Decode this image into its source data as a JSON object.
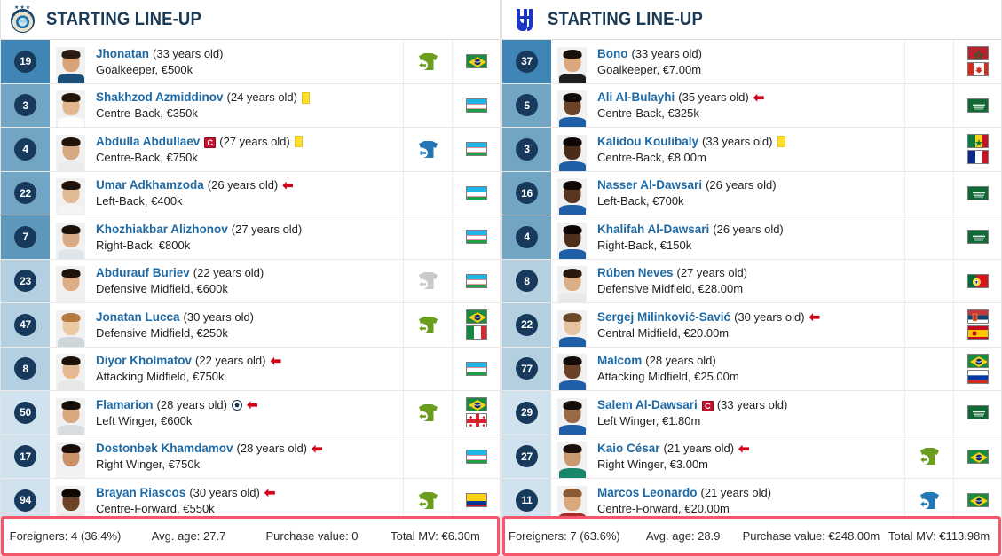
{
  "left": {
    "header": {
      "title": "STARTING LINE-UP",
      "logo_icon": "pakhtakor-crest-icon"
    },
    "players": [
      {
        "number": "19",
        "name": "Jhonatan",
        "age": "(33 years old)",
        "detail": "Goalkeeper, €500k",
        "badges": [],
        "sub_icon": "sub-in-green-shirt-icon",
        "flags": [
          "brazil"
        ],
        "pos_shade": "#3f85b5",
        "skin": "#d8a27a",
        "hair": "#2b1a10",
        "kit": "#1a4f7a"
      },
      {
        "number": "3",
        "name": "Shakhzod Azmiddinov",
        "age": "(24 years old)",
        "detail": "Centre-Back, €350k",
        "badges": [
          "yellow-card"
        ],
        "sub_icon": "",
        "flags": [
          "uzbekistan"
        ],
        "pos_shade": "#72a5c4",
        "skin": "#e0b590",
        "hair": "#241509",
        "kit": "#ffffff"
      },
      {
        "number": "4",
        "name": "Abdulla Abdullaev",
        "age": "(27 years old)",
        "detail": "Centre-Back, €750k",
        "badges": [
          "captain",
          "yellow-card"
        ],
        "sub_icon": "sub-out-blue-shirt-icon",
        "flags": [
          "uzbekistan"
        ],
        "pos_shade": "#72a5c4",
        "skin": "#d7a87f",
        "hair": "#20130a",
        "kit": "#ececec"
      },
      {
        "number": "22",
        "name": "Umar Adkhamzoda",
        "age": "(26 years old)",
        "detail": "Left-Back, €400k",
        "badges": [
          "arrow-out"
        ],
        "sub_icon": "",
        "flags": [
          "uzbekistan"
        ],
        "pos_shade": "#72a5c4",
        "skin": "#e2b996",
        "hair": "#1d1109",
        "kit": "#f4f4f4"
      },
      {
        "number": "7",
        "name": "Khozhiakbar Alizhonov",
        "age": "(27 years old)",
        "detail": "Right-Back, €800k",
        "badges": [],
        "sub_icon": "",
        "flags": [
          "uzbekistan"
        ],
        "pos_shade": "#5d98bb",
        "skin": "#d8ab84",
        "hair": "#1c1008",
        "kit": "#dfe6ea"
      },
      {
        "number": "23",
        "name": "Abdurauf Buriev",
        "age": "(22 years old)",
        "detail": "Defensive Midfield, €600k",
        "badges": [],
        "sub_icon": "sub-grey-shirt-icon",
        "flags": [
          "uzbekistan"
        ],
        "pos_shade": "#b4cfe0",
        "skin": "#dcae86",
        "hair": "#211308",
        "kit": "#f0f0f0"
      },
      {
        "number": "47",
        "name": "Jonatan Lucca",
        "age": "(30 years old)",
        "detail": "Defensive Midfield, €250k",
        "badges": [],
        "sub_icon": "sub-in-green-shirt-icon",
        "flags": [
          "brazil",
          "italy"
        ],
        "pos_shade": "#b4cfe0",
        "skin": "#eccaa6",
        "hair": "#b57a3c",
        "kit": "#cfd6da"
      },
      {
        "number": "8",
        "name": "Diyor Kholmatov",
        "age": "(22 years old)",
        "detail": "Attacking Midfield, €750k",
        "badges": [
          "arrow-out"
        ],
        "sub_icon": "",
        "flags": [
          "uzbekistan"
        ],
        "pos_shade": "#b4cfe0",
        "skin": "#e3b892",
        "hair": "#1b1008",
        "kit": "#e7e7e7"
      },
      {
        "number": "50",
        "name": "Flamarion",
        "age": "(28 years old)",
        "detail": "Left Winger, €600k",
        "badges": [
          "goal",
          "arrow-out"
        ],
        "sub_icon": "sub-in-green-shirt-icon",
        "flags": [
          "brazil",
          "georgia"
        ],
        "pos_shade": "#cfe2ed",
        "skin": "#d9a87c",
        "hair": "#161009",
        "kit": "#d9dde0"
      },
      {
        "number": "17",
        "name": "Dostonbek Khamdamov",
        "age": "(28 years old)",
        "detail": "Right Winger, €750k",
        "badges": [
          "arrow-out"
        ],
        "sub_icon": "",
        "flags": [
          "uzbekistan"
        ],
        "pos_shade": "#cfe2ed",
        "skin": "#c9906a",
        "hair": "#150c06",
        "kit": "#f2f2f2"
      },
      {
        "number": "94",
        "name": "Brayan Riascos",
        "age": "(30 years old)",
        "detail": "Centre-Forward, €550k",
        "badges": [
          "arrow-out"
        ],
        "sub_icon": "sub-in-green-shirt-icon",
        "flags": [
          "colombia"
        ],
        "pos_shade": "#cfe2ed",
        "skin": "#6d4227",
        "hair": "#0f0805",
        "kit": "#e9e9e9"
      }
    ],
    "footer": {
      "foreigners": "Foreigners: 4 (36.4%)",
      "avg_age": "Avg. age: 27.7",
      "purchase_value": "Purchase value: 0",
      "total_mv": "Total MV: €6.30m"
    }
  },
  "right": {
    "header": {
      "title": "STARTING LINE-UP",
      "logo_icon": "al-hilal-crest-icon"
    },
    "players": [
      {
        "number": "37",
        "name": "Bono",
        "age": "(33 years old)",
        "detail": "Goalkeeper, €7.00m",
        "badges": [],
        "sub_icon": "",
        "flags": [
          "morocco",
          "canada"
        ],
        "pos_shade": "#3f85b5",
        "skin": "#d9a87f",
        "hair": "#1a1009",
        "kit": "#1f1f1f"
      },
      {
        "number": "5",
        "name": "Ali Al-Bulayhi",
        "age": "(35 years old)",
        "detail": "Centre-Back, €325k",
        "badges": [
          "arrow-out"
        ],
        "sub_icon": "",
        "flags": [
          "saudi"
        ],
        "pos_shade": "#72a5c4",
        "skin": "#6b4428",
        "hair": "#120a05",
        "kit": "#1f5fa8"
      },
      {
        "number": "3",
        "name": "Kalidou Koulibaly",
        "age": "(33 years old)",
        "detail": "Centre-Back, €8.00m",
        "badges": [
          "yellow-card"
        ],
        "sub_icon": "",
        "flags": [
          "senegal",
          "france"
        ],
        "pos_shade": "#72a5c4",
        "skin": "#4a2c18",
        "hair": "#0c0604",
        "kit": "#1f5fa8"
      },
      {
        "number": "16",
        "name": "Nasser Al-Dawsari",
        "age": "(26 years old)",
        "detail": "Left-Back, €700k",
        "badges": [],
        "sub_icon": "",
        "flags": [
          "saudi"
        ],
        "pos_shade": "#72a5c4",
        "skin": "#5a3620",
        "hair": "#100806",
        "kit": "#1f5fa8"
      },
      {
        "number": "4",
        "name": "Khalifah Al-Dawsari",
        "age": "(26 years old)",
        "detail": "Right-Back, €150k",
        "badges": [],
        "sub_icon": "",
        "flags": [
          "saudi"
        ],
        "pos_shade": "#72a5c4",
        "skin": "#4e2f1c",
        "hair": "#0d0604",
        "kit": "#1f5fa8"
      },
      {
        "number": "8",
        "name": "Rúben Neves",
        "age": "(27 years old)",
        "detail": "Defensive Midfield, €28.00m",
        "badges": [],
        "sub_icon": "",
        "flags": [
          "portugal"
        ],
        "pos_shade": "#b4cfe0",
        "skin": "#dcae86",
        "hair": "#2a1a0e",
        "kit": "#e9e9e9"
      },
      {
        "number": "22",
        "name": "Sergej Milinković-Savić",
        "age": "(30 years old)",
        "detail": "Central Midfield, €20.00m",
        "badges": [
          "arrow-out"
        ],
        "sub_icon": "",
        "flags": [
          "serbia",
          "spain"
        ],
        "pos_shade": "#b4cfe0",
        "skin": "#e6c2a0",
        "hair": "#6b4a2a",
        "kit": "#1f5fa8"
      },
      {
        "number": "77",
        "name": "Malcom",
        "age": "(28 years old)",
        "detail": "Attacking Midfield, €25.00m",
        "badges": [],
        "sub_icon": "",
        "flags": [
          "brazil",
          "russia"
        ],
        "pos_shade": "#b4cfe0",
        "skin": "#6a4128",
        "hair": "#120a06",
        "kit": "#1f5fa8"
      },
      {
        "number": "29",
        "name": "Salem Al-Dawsari",
        "age": "(33 years old)",
        "detail": "Left Winger, €1.80m",
        "badges": [
          "captain"
        ],
        "sub_icon": "",
        "flags": [
          "saudi"
        ],
        "pos_shade": "#cfe2ed",
        "skin": "#9a6a45",
        "hair": "#150d07",
        "kit": "#1f5fa8"
      },
      {
        "number": "27",
        "name": "Kaio César",
        "age": "(21 years old)",
        "detail": "Right Winger, €3.00m",
        "badges": [
          "arrow-out"
        ],
        "sub_icon": "sub-in-green-shirt-icon",
        "flags": [
          "brazil"
        ],
        "pos_shade": "#cfe2ed",
        "skin": "#c99a72",
        "hair": "#1c110a",
        "kit": "#18866b"
      },
      {
        "number": "11",
        "name": "Marcos Leonardo",
        "age": "(21 years old)",
        "detail": "Centre-Forward, €20.00m",
        "badges": [],
        "sub_icon": "sub-out-blue-shirt-icon",
        "flags": [
          "brazil"
        ],
        "pos_shade": "#cfe2ed",
        "skin": "#d9a87c",
        "hair": "#8a5a32",
        "kit": "#a62b2b"
      }
    ],
    "footer": {
      "foreigners": "Foreigners: 7 (63.6%)",
      "avg_age": "Avg. age: 28.9",
      "purchase_value": "Purchase value: €248.00m",
      "total_mv": "Total MV: €113.98m"
    }
  },
  "colors": {
    "name_link": "#1f6aa5",
    "badge_bg": "#17395c",
    "sub_in": "#6b9e1e",
    "sub_out": "#2478b5",
    "sub_grey": "#c9c9c9",
    "footer_highlight": "#f4566b"
  }
}
